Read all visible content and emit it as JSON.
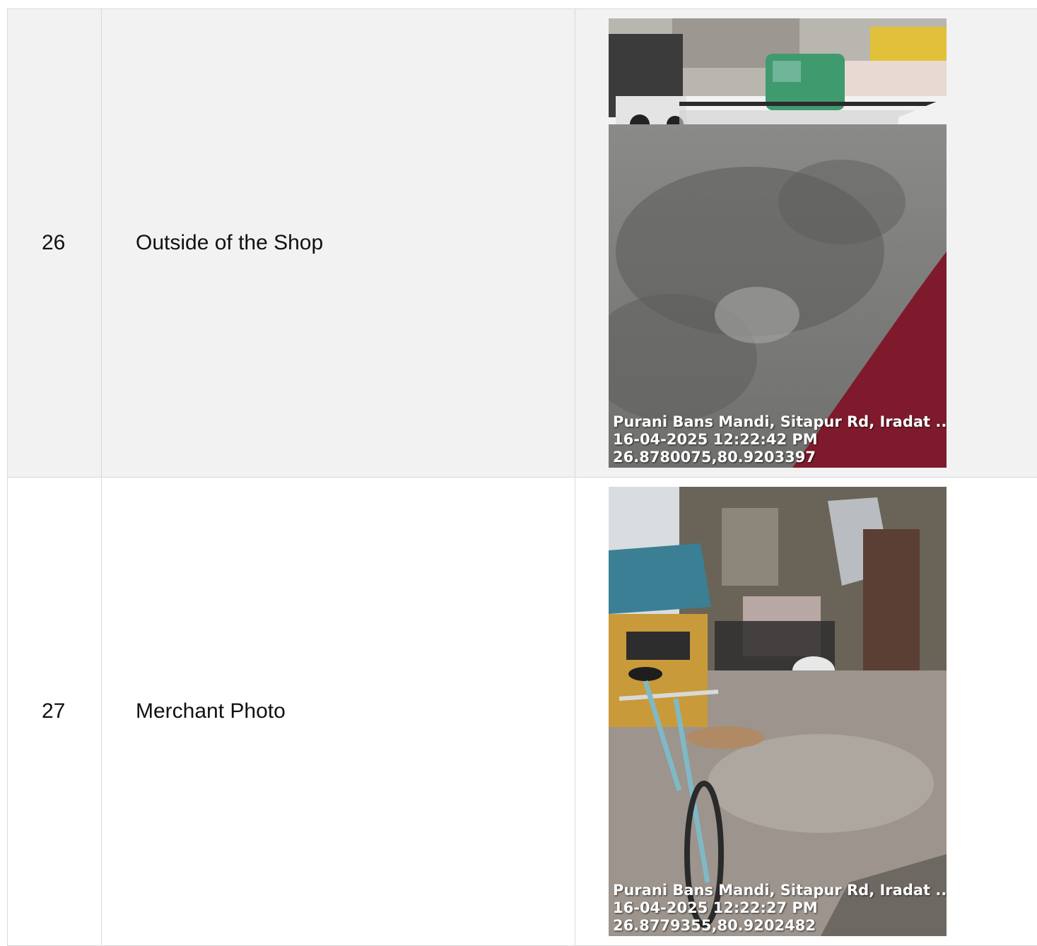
{
  "rows": [
    {
      "number": "26",
      "label": "Outside of the Shop",
      "photo": {
        "scene": "street-road-photo",
        "caption_location": "Purani Bans Mandi, Sitapur Rd, Iradat ...",
        "caption_datetime": "16-04-2025 12:22:42 PM",
        "caption_coords": "26.8780075,80.9203397"
      }
    },
    {
      "number": "27",
      "label": "Merchant Photo",
      "photo": {
        "scene": "bicycle-lane-photo",
        "caption_location": "Purani Bans Mandi, Sitapur Rd, Iradat ...",
        "caption_datetime": "16-04-2025 12:22:27 PM",
        "caption_coords": "26.8779355,80.9202482"
      }
    }
  ]
}
